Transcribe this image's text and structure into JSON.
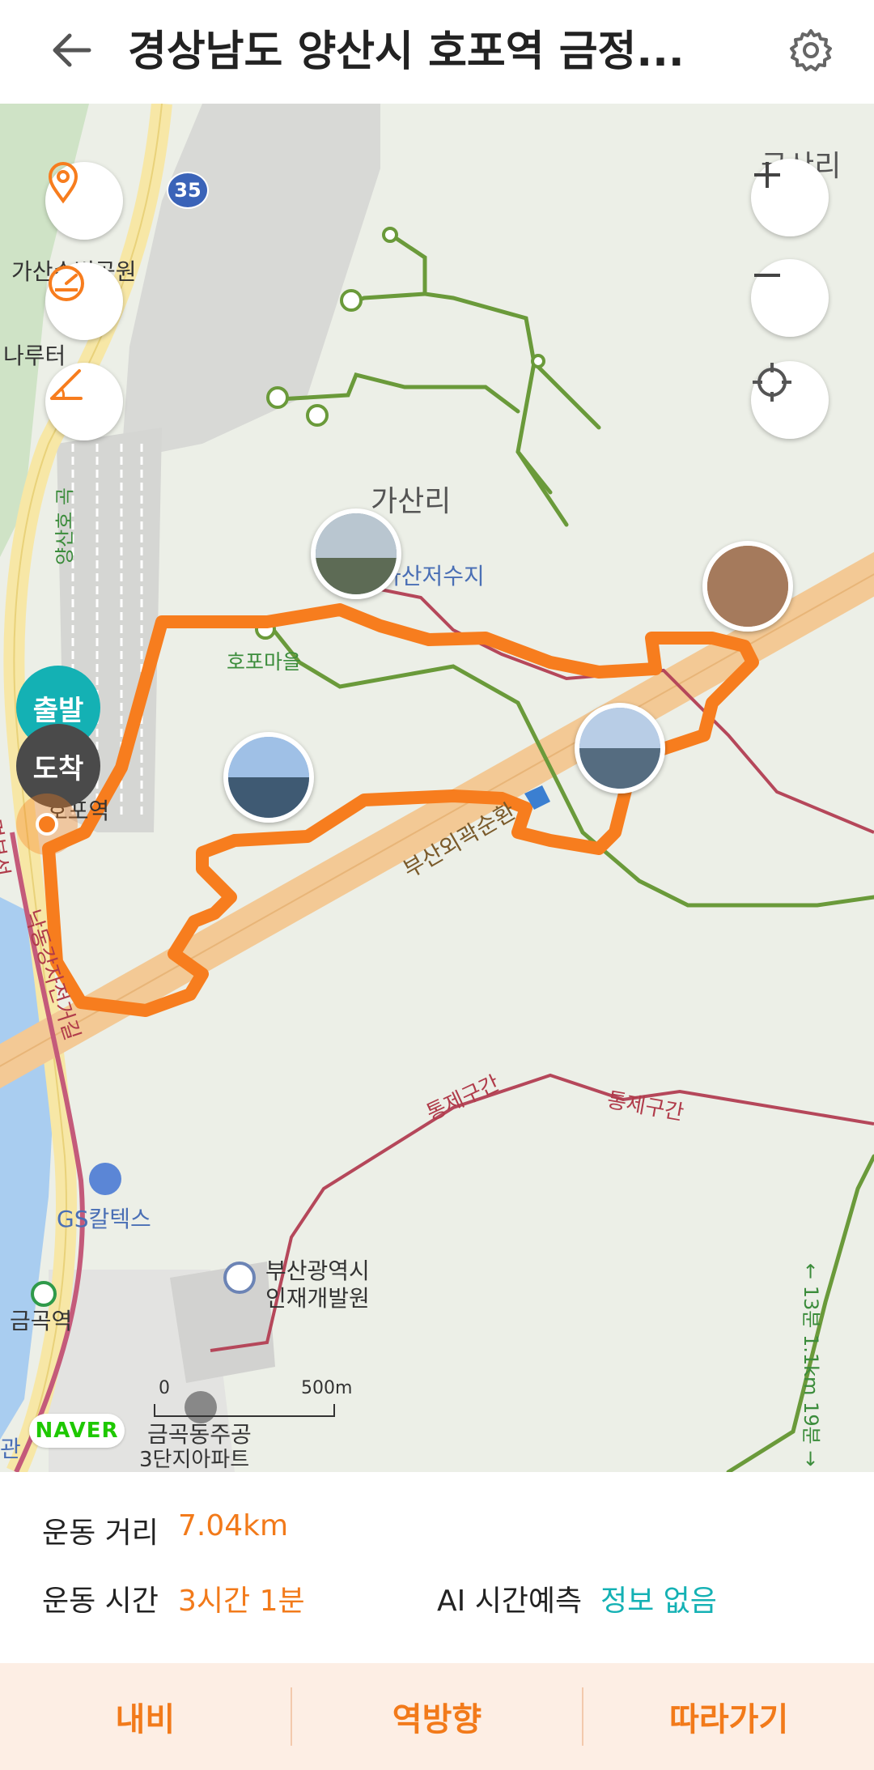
{
  "header": {
    "title": "경상남도 양산시 호포역 금정...",
    "back_icon": "arrow-left-icon",
    "settings_icon": "gear-icon"
  },
  "map": {
    "controls_left": [
      "location-pin-icon",
      "speedometer-icon",
      "slope-icon"
    ],
    "controls_right": [
      "zoom-in-icon",
      "zoom-out-icon",
      "locate-me-icon"
    ],
    "labels": {
      "park": "가산수변공원",
      "ferry": "나루터",
      "village_top": "금산리",
      "village_mid": "가산리",
      "reservoir": "가산저수지",
      "hopo_village": "호포마을",
      "highway": "부산외곽순환",
      "restricted_1": "통제구간",
      "restricted_2": "통제구간",
      "gs": "GS칼텍스",
      "institute_line1": "부산광역시",
      "institute_line2": "인재개발원",
      "station": "금곡역",
      "apt_line1": "금곡동주공",
      "apt_line2": "3단지아파트",
      "road_35": "35",
      "bike_road": "낙동강자전거길",
      "trail_vertical": "← 13분 1.1km 19분 →",
      "station_hopo": "호포역",
      "line_label": "경부선",
      "station_left": "관",
      "road_vertical_left": "양산호 곡"
    },
    "start_label": "출발",
    "end_label": "도착",
    "scale": {
      "zero": "0",
      "distance": "500m"
    },
    "brand": "NAVER",
    "colors": {
      "route": "#f77d1e",
      "trail": "#6a9a3a",
      "restricted": "#b5475a",
      "highway": "#f3c995",
      "water": "#a9cdf0",
      "start": "#14b1b4",
      "end": "#4a4a4a"
    }
  },
  "stats": {
    "distance_label": "운동 거리",
    "distance_value": "7.04km",
    "time_label": "운동 시간",
    "time_value": "3시간 1분",
    "ai_label": "AI 시간예측",
    "ai_value": "정보 없음"
  },
  "actions": {
    "navi": "내비",
    "reverse": "역방향",
    "follow": "따라가기"
  }
}
